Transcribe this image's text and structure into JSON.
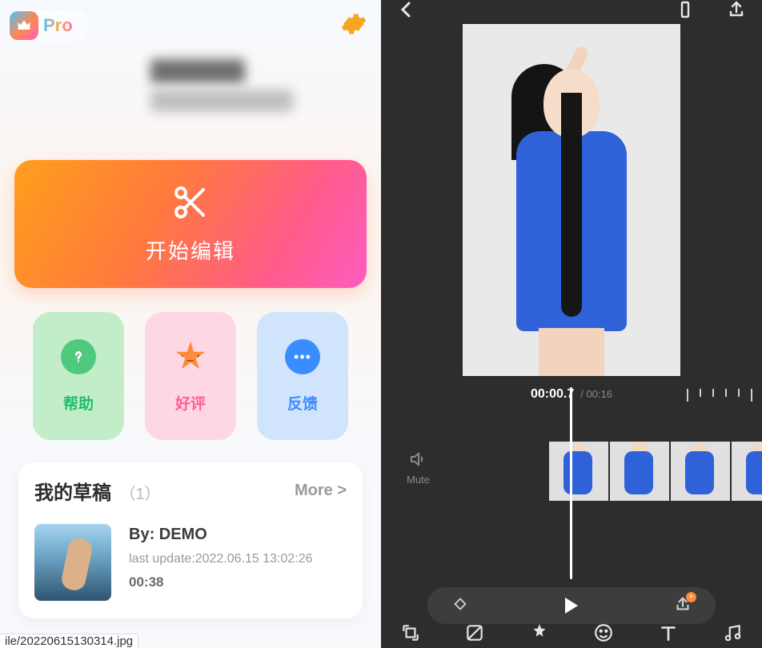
{
  "left": {
    "pro_label": "Pro",
    "start_label": "开始编辑",
    "actions": {
      "help": {
        "label": "帮助"
      },
      "rate": {
        "label": "好评"
      },
      "feedback": {
        "label": "反馈"
      }
    },
    "drafts": {
      "title": "我的草稿",
      "count_label": "（1）",
      "more_label": "More >",
      "items": [
        {
          "by_label": "By: DEMO",
          "updated_label": "last update:2022.06.15 13:02:26",
          "duration": "00:38"
        }
      ]
    },
    "file_hint": "ile/20220615130314.jpg"
  },
  "right": {
    "time_current": "00:00.7",
    "time_total": "/ 00:16",
    "mute_label": "Mute"
  }
}
